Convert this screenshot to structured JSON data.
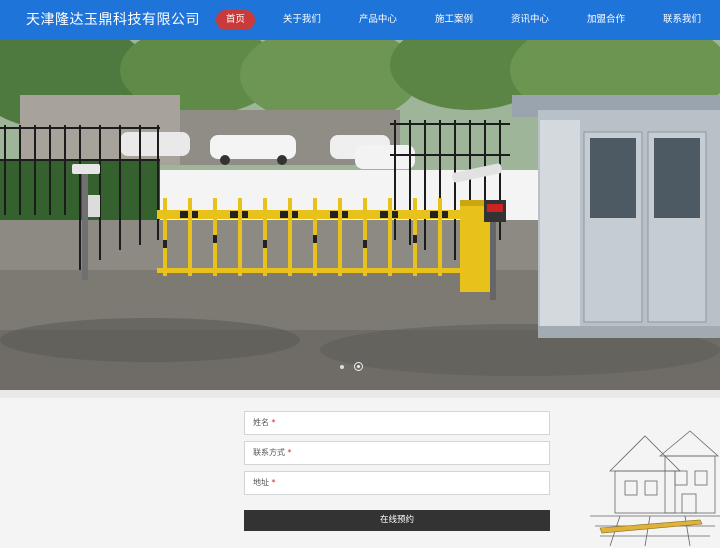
{
  "header": {
    "company_name": "天津隆达玉鼎科技有限公司",
    "nav": [
      "首页",
      "关于我们",
      "产品中心",
      "施工案例",
      "资讯中心",
      "加盟合作",
      "联系我们"
    ],
    "active_index": 0
  },
  "banner": {
    "slide_count": 2,
    "active_slide": 1
  },
  "form": {
    "fields": [
      {
        "label": "姓名",
        "required_mark": "*"
      },
      {
        "label": "联系方式",
        "required_mark": "*"
      },
      {
        "label": "地址",
        "required_mark": "*"
      }
    ],
    "submit_label": "在线预约"
  },
  "colors": {
    "header_bg": "#1f74d9",
    "nav_active_bg": "#c93a3a",
    "barrier_yellow": "#e8c21a",
    "submit_bg": "#333333"
  }
}
